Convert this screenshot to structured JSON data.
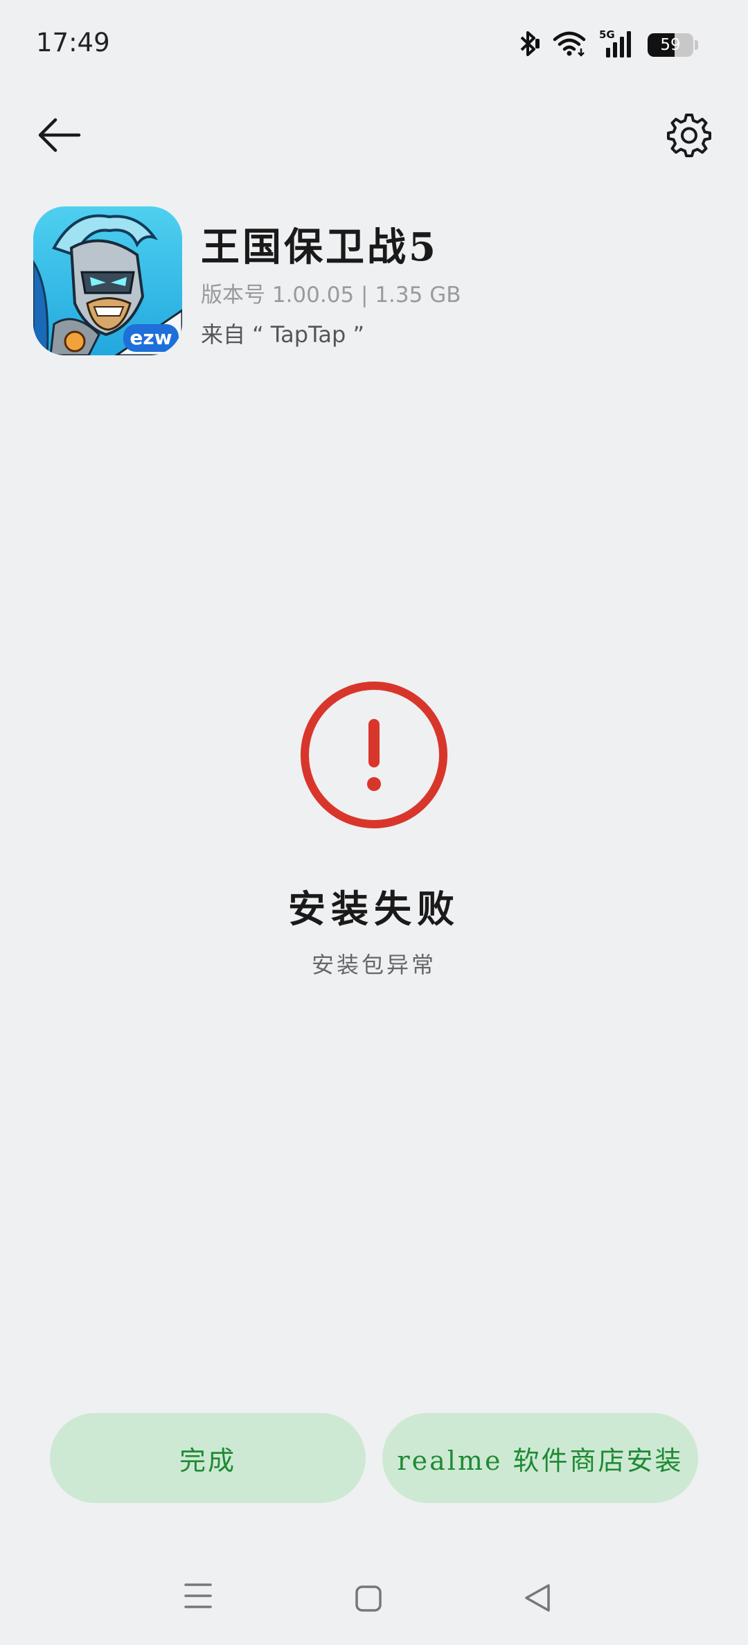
{
  "status_bar": {
    "time": "17:49",
    "battery_percent": "59",
    "battery_level": 0.59,
    "icons": [
      "bluetooth-icon",
      "wifi-icon",
      "5g-signal-icon",
      "battery-icon"
    ],
    "network_label": "5G"
  },
  "nav": {
    "back_icon": "arrow-left-icon",
    "settings_icon": "gear-icon"
  },
  "app": {
    "name": "王国保卫战5",
    "version_line": "版本号 1.00.05 | 1.35 GB",
    "source_line": "来自 “ TapTap ”",
    "icon_badge": "ezw"
  },
  "error": {
    "title": "安装失败",
    "subtitle": "安装包异常",
    "color": "#d9362b"
  },
  "buttons": {
    "done_label": "完成",
    "store_label": "realme 软件商店安装",
    "bg_color": "#cde9d3",
    "text_color": "#1f8a34"
  },
  "system_nav": {
    "icons": [
      "menu-icon",
      "home-icon",
      "back-triangle-icon"
    ]
  }
}
